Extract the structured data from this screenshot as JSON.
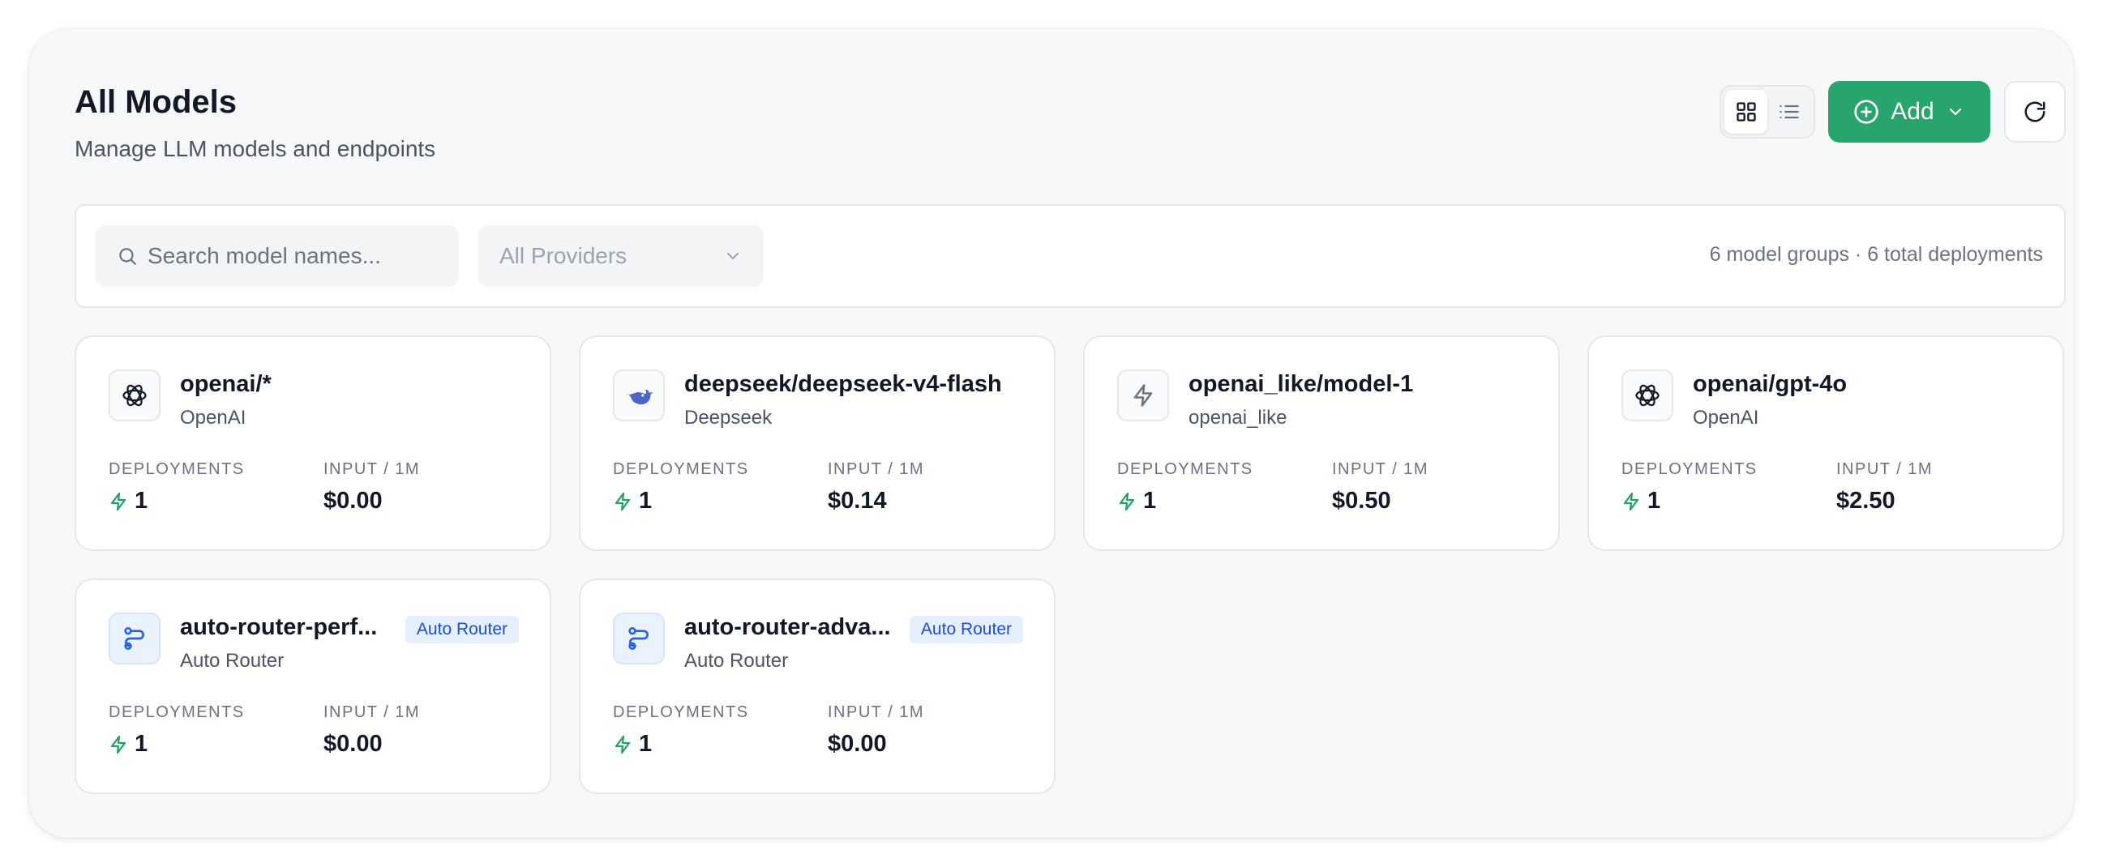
{
  "header": {
    "title": "All Models",
    "subtitle": "Manage LLM models and endpoints",
    "add_label": "Add"
  },
  "filters": {
    "search_placeholder": "Search model names...",
    "provider_selected": "All Providers",
    "summary": "6 model groups · 6 total deployments"
  },
  "labels": {
    "deployments": "DEPLOYMENTS",
    "input_price": "INPUT / 1M"
  },
  "colors": {
    "accent": "#27a56d",
    "badge_bg": "#e6f0fd",
    "badge_text": "#1d4ed8",
    "deploy_icon": "#22a163"
  },
  "models": [
    {
      "name": "openai/*",
      "provider": "OpenAI",
      "icon": "openai-icon",
      "deployments": "1",
      "input_price": "$0.00"
    },
    {
      "name": "deepseek/deepseek-v4-flash",
      "provider": "Deepseek",
      "icon": "deepseek-whale-icon",
      "deployments": "1",
      "input_price": "$0.14"
    },
    {
      "name": "openai_like/model-1",
      "provider": "openai_like",
      "icon": "lightning-icon",
      "deployments": "1",
      "input_price": "$0.50"
    },
    {
      "name": "openai/gpt-4o",
      "provider": "OpenAI",
      "icon": "openai-icon",
      "deployments": "1",
      "input_price": "$2.50"
    },
    {
      "name": "auto-router-perf...",
      "provider": "Auto Router",
      "icon": "route-icon",
      "badge": "Auto Router",
      "deployments": "1",
      "input_price": "$0.00"
    },
    {
      "name": "auto-router-adva...",
      "provider": "Auto Router",
      "icon": "route-icon",
      "badge": "Auto Router",
      "deployments": "1",
      "input_price": "$0.00"
    }
  ]
}
